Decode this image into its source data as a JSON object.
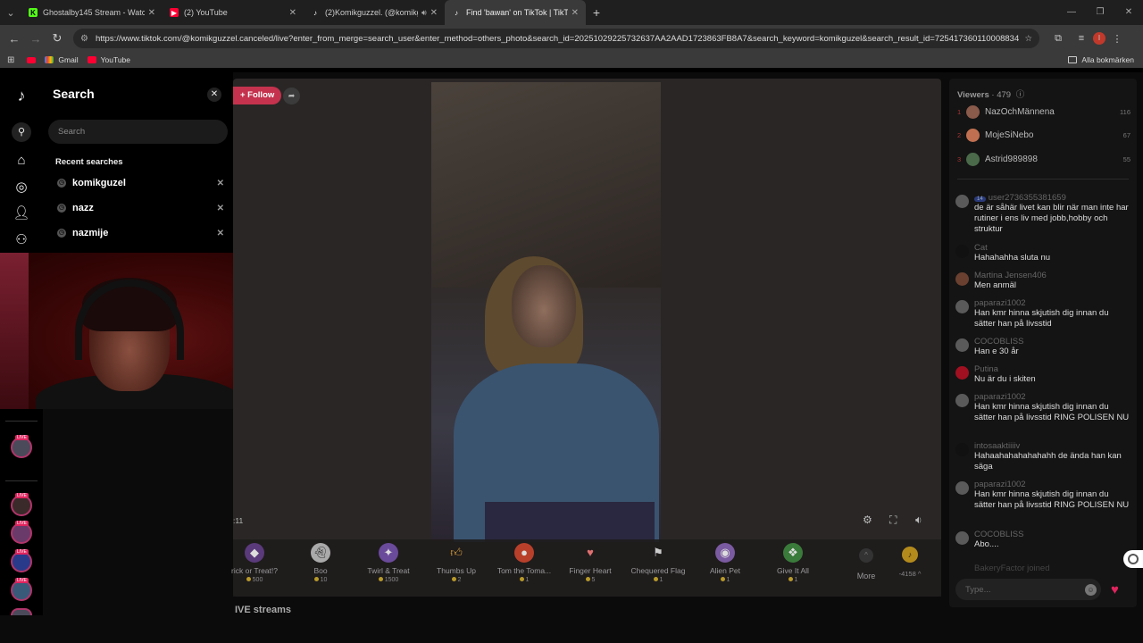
{
  "tabs": [
    {
      "title": "Ghostalby145 Stream - Watch L",
      "favicon": "kick-icon",
      "color": "#53fc18"
    },
    {
      "title": "(2) YouTube",
      "favicon": "youtube-icon",
      "color": "#ff0033"
    },
    {
      "title": "(2)Komikguzzel. (@komikgu",
      "favicon": "tiktok-icon",
      "color": "#ffffff"
    },
    {
      "title": "Find 'bawan' on TikTok | TikTok",
      "favicon": "tiktok-icon",
      "color": "#ffffff"
    }
  ],
  "address_bar": {
    "url": "https://www.tiktok.com/@komikguzzel.canceled/live?enter_from_merge=search_user&enter_method=others_photo&search_id=20251029225732637AA2AAD1723863FB8A7&search_keyword=komikguzel&search_result_id=7254173601100088346&se..."
  },
  "bookmarks": {
    "items": [
      {
        "label": "Gmail"
      },
      {
        "label": "YouTube"
      }
    ],
    "all_label": "Alla bokmärken"
  },
  "search_panel": {
    "title": "Search",
    "placeholder": "Search",
    "recent_title": "Recent searches",
    "recent": [
      "komikguzel",
      "nazz",
      "nazmije"
    ]
  },
  "live": {
    "follow_label": "+ Follow",
    "timer": ":11",
    "more_label": "More",
    "coins_label": "-4158 ^",
    "section_title": "IVE streams"
  },
  "gifts": [
    {
      "name": "rick or Treat!?",
      "price": "500"
    },
    {
      "name": "Boo",
      "price": "10"
    },
    {
      "name": "Twirl & Treat",
      "price": "1500"
    },
    {
      "name": "Thumbs Up",
      "price": "2"
    },
    {
      "name": "Tom the Toma...",
      "price": "1"
    },
    {
      "name": "Finger Heart",
      "price": "5"
    },
    {
      "name": "Chequered Flag",
      "price": "1"
    },
    {
      "name": "Alien Pet",
      "price": "1"
    },
    {
      "name": "Give It All",
      "price": "1"
    }
  ],
  "viewers": {
    "label": "Viewers",
    "count": "· 479",
    "list": [
      {
        "rank": "1",
        "name": "NazOchMännena",
        "score": "116",
        "color": "#8a5a4a"
      },
      {
        "rank": "2",
        "name": "MojeSiNebo",
        "score": "67",
        "color": "#c07050"
      },
      {
        "rank": "3",
        "name": "Astrid989898",
        "score": "55",
        "color": "#4a6a4a"
      }
    ]
  },
  "chat": [
    {
      "user": "user2736355381659",
      "badge": "14",
      "text": "de är såhär livet kan blir när man inte har rutiner i ens liv med jobb,hobby och struktur"
    },
    {
      "user": "Cat",
      "text": "Hahahahha sluta nu"
    },
    {
      "user": "Martina Jensen406",
      "text": "Men anmäl"
    },
    {
      "user": "paparazi1002",
      "text": "Han kmr hinna skjutish dig innan du sätter han på livsstid"
    },
    {
      "user": "COCOBLISS",
      "text": "Han e 30 år"
    },
    {
      "user": "Putina",
      "text": "Nu är du i skiten"
    },
    {
      "user": "paparazi1002",
      "text": "Han kmr hinna skjutish dig innan du sätter han på livsstid RING POLISEN NU"
    },
    {
      "user": "intosaaktiiiiv",
      "text": "Hahaahahahahahahh de ända han kan säga"
    },
    {
      "user": "paparazi1002",
      "text": "Han kmr hinna skjutish dig innan du sätter han på livsstid RING POLISEN NU"
    },
    {
      "user": "COCOBLISS",
      "text": "Abo...."
    },
    {
      "user": "BakeryFactor",
      "text": "joined"
    }
  ],
  "chat_input": {
    "placeholder": "Type..."
  }
}
